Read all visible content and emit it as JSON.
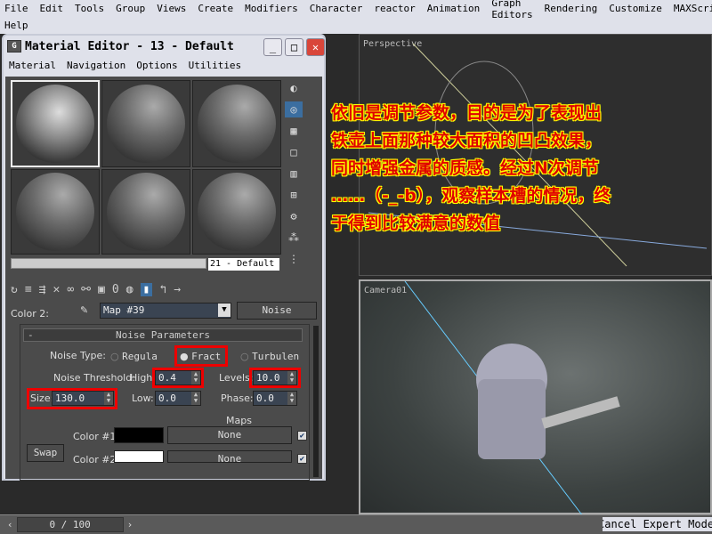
{
  "menubar": {
    "items": [
      "File",
      "Edit",
      "Tools",
      "Group",
      "Views",
      "Create",
      "Modifiers",
      "Character",
      "reactor",
      "Animation",
      "Graph Editors",
      "Rendering",
      "Customize",
      "MAXScript"
    ],
    "help": "Help"
  },
  "viewports": {
    "perspective": "Perspective",
    "camera": "Camera01"
  },
  "material_editor": {
    "title": "Material Editor - 13 - Default",
    "logo": "G",
    "menu": [
      "Material",
      "Navigation",
      "Options",
      "Utilities"
    ],
    "slot_name": "21 - Default",
    "color2_label": "Color 2:",
    "map_name": "Map #39",
    "map_type": "Noise",
    "rollout_collapse": "-",
    "rollout_title": "Noise Parameters",
    "noise_type_label": "Noise Type:",
    "noise_types": [
      "Regula",
      "Fract",
      "Turbulen"
    ],
    "selected_noise_type": "Fract",
    "threshold_label": "Noise Threshold:",
    "high_label": "High",
    "high_value": "0.4",
    "levels_label": "Levels:",
    "levels_value": "10.0",
    "size_label": "Size:",
    "size_value": "130.0",
    "low_label": "Low:",
    "low_value": "0.0",
    "phase_label": "Phase:",
    "phase_value": "0.0",
    "maps_label": "Maps",
    "color1_label": "Color #1",
    "color2b_label": "Color #2",
    "color1": "#000000",
    "color2": "#ffffff",
    "map1": "None",
    "map2": "None",
    "swap": "Swap",
    "toolbar_zero": "0"
  },
  "annotation": [
    "依旧是调节参数，目的是为了表现出",
    "铁壶上面那种较大面积的凹凸效果，",
    "同时增强金属的质感。经过N次调节",
    "……（-_-b），观察样本槽的情况，终",
    "于得到比较满意的数值"
  ],
  "status": {
    "time": "0 / 100",
    "expert": "Cancel Expert Mode"
  }
}
